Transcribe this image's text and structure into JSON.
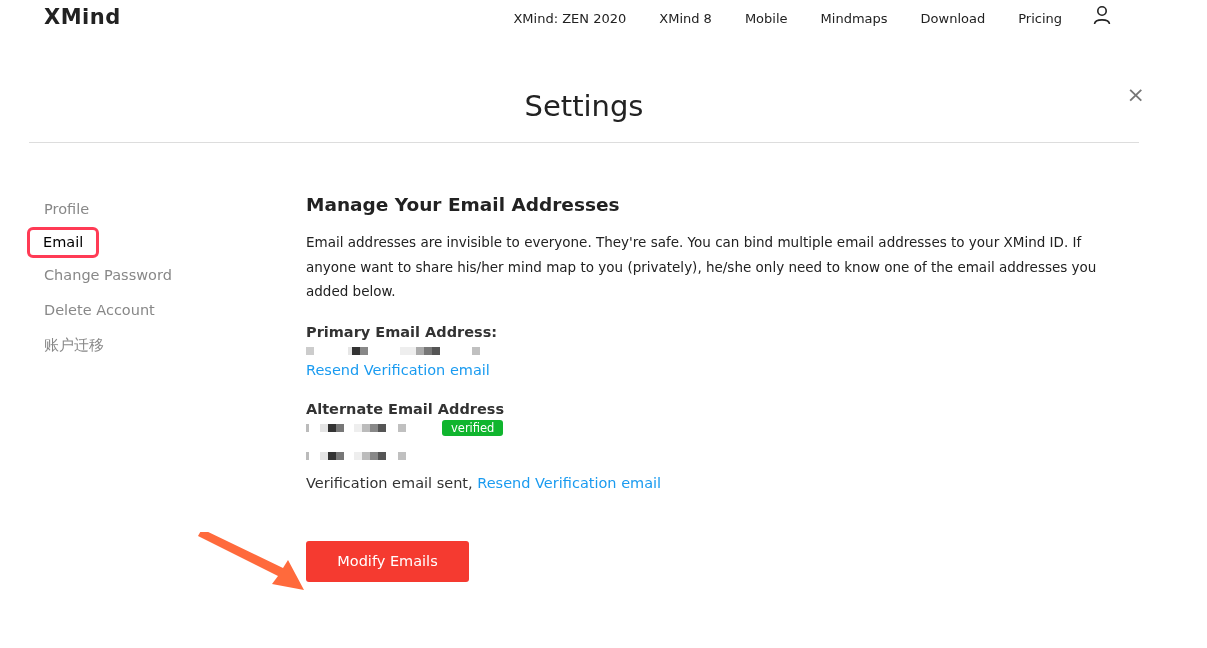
{
  "header": {
    "logo": "XMind",
    "nav": [
      "XMind: ZEN 2020",
      "XMind 8",
      "Mobile",
      "Mindmaps",
      "Download",
      "Pricing"
    ]
  },
  "title": "Settings",
  "close": "×",
  "sidebar": {
    "items": [
      {
        "label": "Profile",
        "selected": false
      },
      {
        "label": "Email",
        "selected": true
      },
      {
        "label": "Change Password",
        "selected": false
      },
      {
        "label": "Delete Account",
        "selected": false
      },
      {
        "label": "账户迁移",
        "selected": false
      }
    ]
  },
  "content": {
    "heading": "Manage Your Email Addresses",
    "description": "Email addresses are invisible to everyone. They're safe. You can bind multiple email addresses to your XMind ID. If anyone want to share his/her mind map to you (privately), he/she only need to know one of the email addresses you added below.",
    "primary": {
      "label": "Primary Email Address:",
      "link": "Resend Verification email"
    },
    "alternate": {
      "label": "Alternate Email Address",
      "emails": [
        {
          "badge": "verified",
          "verified": true
        },
        {
          "verified": false,
          "note": "Verification email sent,",
          "link": "Resend Verification email"
        }
      ]
    },
    "button": "Modify Emails"
  }
}
